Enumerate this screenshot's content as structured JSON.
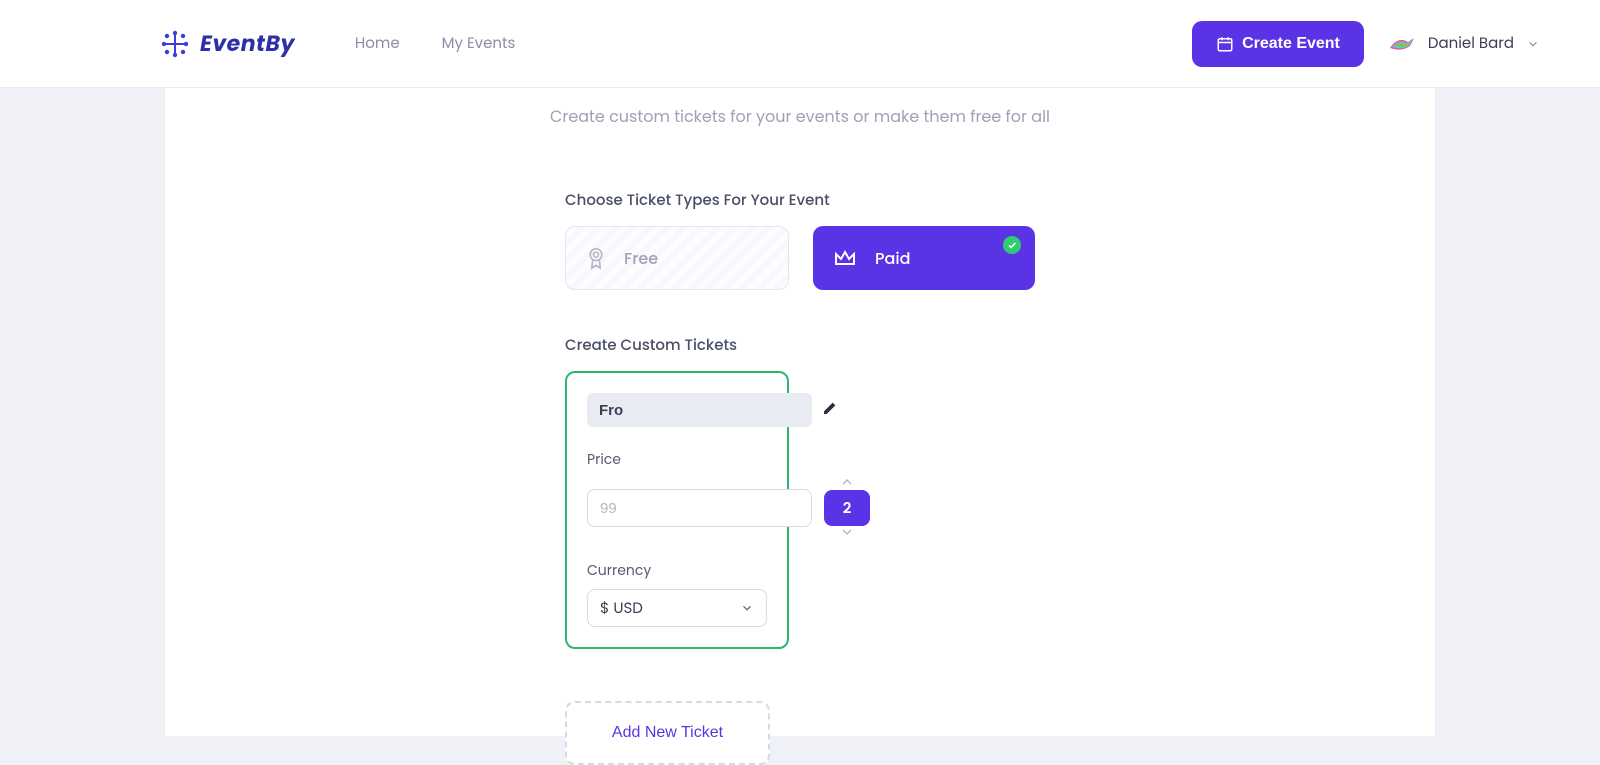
{
  "brand": {
    "name": "EventBy"
  },
  "nav": {
    "home": "Home",
    "my_events": "My Events"
  },
  "header": {
    "create_event": "Create Event",
    "user_name": "Daniel Bard"
  },
  "page": {
    "subheading": "Create custom tickets for your events or make them free for all",
    "choose_types_label": "Choose Ticket Types For Your Event",
    "custom_tickets_label": "Create Custom Tickets",
    "add_ticket": "Add New Ticket"
  },
  "ticket_types": {
    "free": "Free",
    "paid": "Paid",
    "selected": "paid"
  },
  "ticket": {
    "name": "Fro",
    "price_label": "Price",
    "price_placeholder": "99",
    "price_value": "",
    "qty": "2",
    "currency_label": "Currency",
    "currency_value": "$ USD"
  }
}
